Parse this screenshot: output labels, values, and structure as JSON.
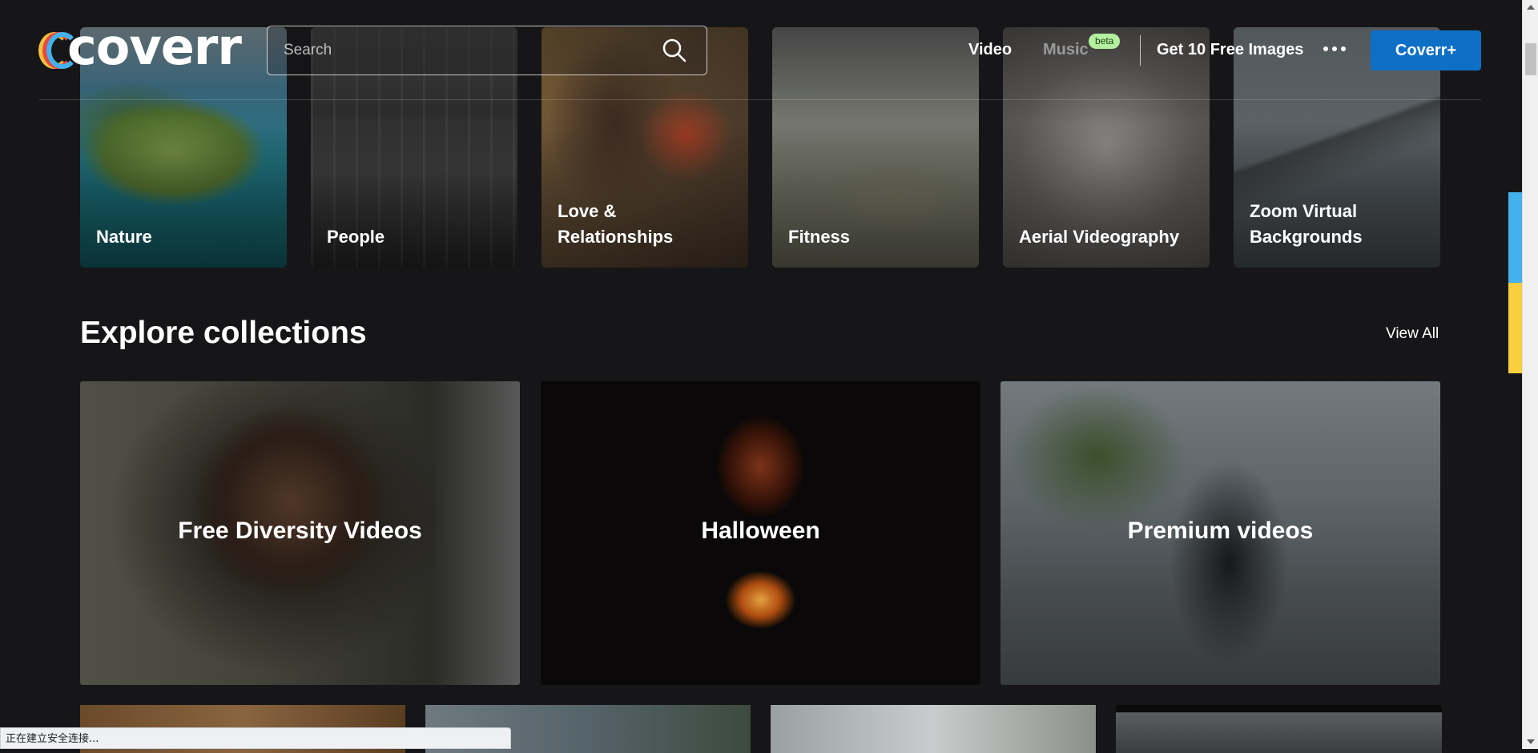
{
  "header": {
    "logo_text": "coverr",
    "search_placeholder": "Search",
    "nav": {
      "video": "Video",
      "music": "Music",
      "music_badge": "beta",
      "free_images": "Get 10 Free Images",
      "cta": "Coverr+"
    },
    "colors": {
      "cta": "#0e6fc7",
      "badge": "#b4f0a0",
      "logo_rings": [
        "#f5c23c",
        "#e9473f",
        "#43b2ec"
      ]
    }
  },
  "categories": [
    {
      "label": "Nature"
    },
    {
      "label": "People"
    },
    {
      "label": "Love & Relationships"
    },
    {
      "label": "Fitness"
    },
    {
      "label": "Aerial Videography"
    },
    {
      "label": "Zoom Virtual Backgrounds"
    }
  ],
  "collections": {
    "title": "Explore collections",
    "view_all": "View All",
    "items": [
      {
        "label": "Free Diversity Videos"
      },
      {
        "label": "Halloween"
      },
      {
        "label": "Premium videos"
      }
    ]
  },
  "status_bar": {
    "text": "正在建立安全连接..."
  }
}
